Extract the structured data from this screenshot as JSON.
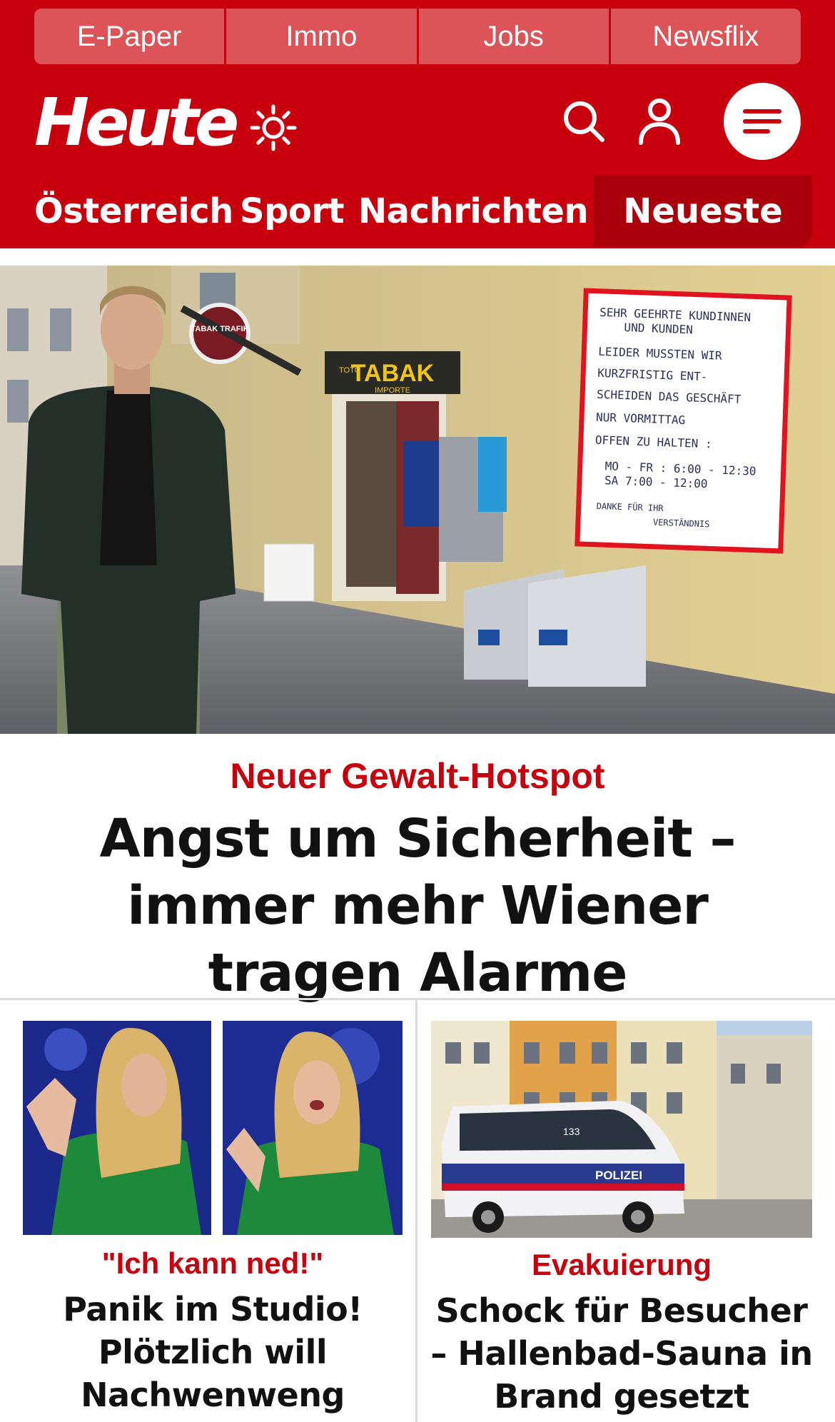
{
  "header": {
    "top_links": [
      "E-Paper",
      "Immo",
      "Jobs",
      "Newsflix"
    ],
    "logo": "Heute",
    "icons": [
      "sun-icon",
      "search-icon",
      "user-icon",
      "menu-icon"
    ]
  },
  "nav": {
    "items": [
      "Österreich",
      "Sport",
      "Nachrichten"
    ],
    "active": "Neueste"
  },
  "hero": {
    "kicker": "Neuer Gewalt-Hotspot",
    "title": "Angst um Sicherheit – immer mehr Wiener tragen Alarme",
    "image": {
      "shop_sign": "TABAK",
      "shop_sub": "IMPORTE",
      "toto": "TOTO",
      "trafik_label": "TABAK TRAFIK",
      "note_lines": [
        "SEHR GEEHRTE KUNDINNEN",
        "UND KUNDEN",
        "LEIDER MUSSTEN WIR",
        "KURZFRISTIG ENT-",
        "SCHEIDEN DAS GESCHÄFT",
        "NUR VORMITTAG",
        "OFFEN ZU HALTEN :",
        "MO - FR : 6:00 - 12:30",
        "SA 7:00 - 12:00",
        "DANKE FÜR IHR",
        "VERSTÄNDNIS"
      ]
    }
  },
  "teasers": [
    {
      "kicker": "\"Ich kann ned!\"",
      "title": "Panik im Studio! Plötzlich will Nachwenweng fliehen"
    },
    {
      "kicker": "Evakuierung",
      "title": "Schock für Besucher – Hallenbad-Sauna in Brand gesetzt",
      "image": {
        "van_label": "POLIZEI",
        "van_number": "133"
      }
    }
  ],
  "colors": {
    "brand_red": "#c8000e",
    "link_bg": "#dc5358",
    "nav_active_bg": "#a9000b",
    "divider": "#dcdcdc"
  }
}
